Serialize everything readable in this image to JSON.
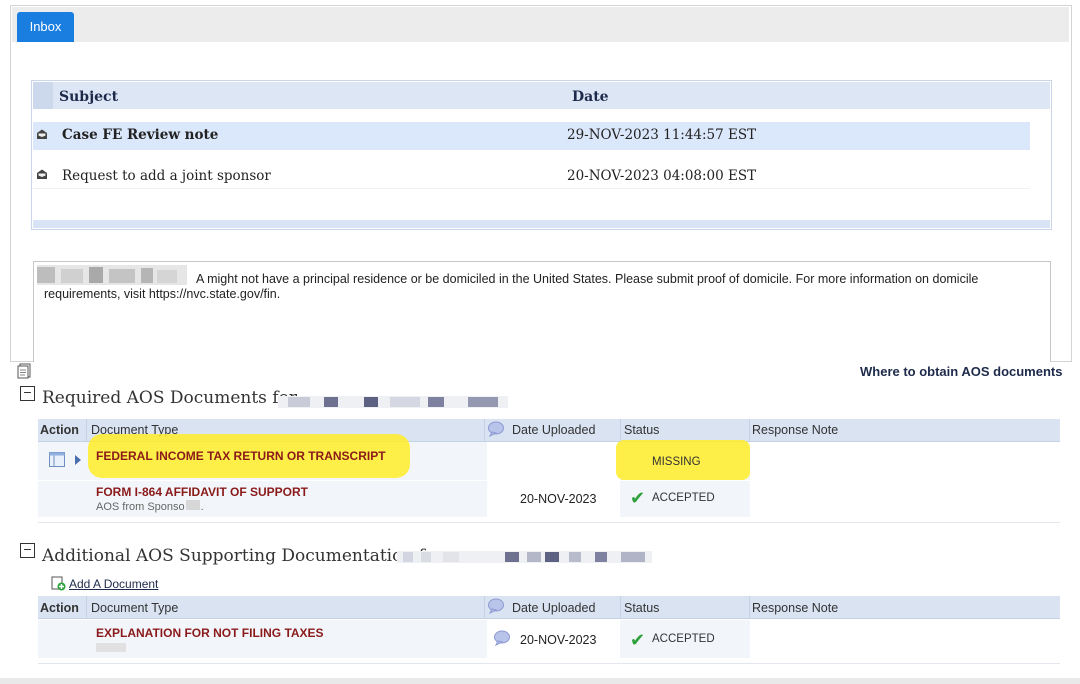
{
  "tabs": [
    {
      "label": "Inbox",
      "active": true
    }
  ],
  "inbox": {
    "columns": {
      "subject": "Subject",
      "date": "Date"
    },
    "rows": [
      {
        "subject": "Case FE Review note",
        "date": "29-NOV-2023 11:44:57 EST",
        "selected": true
      },
      {
        "subject": "Request to add a joint sponsor",
        "date": "20-NOV-2023 04:08:00 EST",
        "selected": false
      }
    ]
  },
  "message": {
    "line1": "A might not have a principal residence or be domiciled in the United States. Please submit proof of domicile. For more information on domicile",
    "line2": "requirements, visit https://nvc.state.gov/fin."
  },
  "required_section": {
    "title": "Required AOS Documents for",
    "collapse_symbol": "−",
    "link": "Where to obtain AOS documents",
    "columns": {
      "action": "Action",
      "doc_type": "Document Type",
      "date_uploaded": "Date Uploaded",
      "status": "Status",
      "response_note": "Response Note"
    },
    "rows": [
      {
        "doc_type": "FEDERAL INCOME TAX RETURN OR TRANSCRIPT",
        "sub_note": "",
        "date_uploaded": "",
        "status": "MISSING"
      },
      {
        "doc_type": "FORM I-864 AFFIDAVIT OF SUPPORT",
        "sub_note": "AOS from Sponso",
        "sub_note_end": ".",
        "date_uploaded": "20-NOV-2023",
        "status": "ACCEPTED"
      }
    ]
  },
  "additional_section": {
    "title": "Additional AOS Supporting Documentation fo",
    "collapse_symbol": "−",
    "add_link": "Add A Document",
    "columns": {
      "action": "Action",
      "doc_type": "Document Type",
      "date_uploaded": "Date Uploaded",
      "status": "Status",
      "response_note": "Response Note"
    },
    "rows": [
      {
        "doc_type": "EXPLANATION FOR NOT FILING TAXES",
        "sub_note": "",
        "date_uploaded": "20-NOV-2023",
        "status": "ACCEPTED"
      }
    ]
  },
  "icons": {
    "mail": "envelope-open-icon",
    "document": "document-icon",
    "comment": "speech-bubble-icon",
    "check": "checkmark-icon",
    "expand": "expand-arrow-icon",
    "grid": "view-document-icon",
    "add": "add-document-icon"
  },
  "colors": {
    "tab_active": "#1a7ee0",
    "header_bg": "#d9e3f2",
    "doc_type_text": "#8a1a1a",
    "check": "#2ea13a",
    "highlight": "#ffec28"
  }
}
